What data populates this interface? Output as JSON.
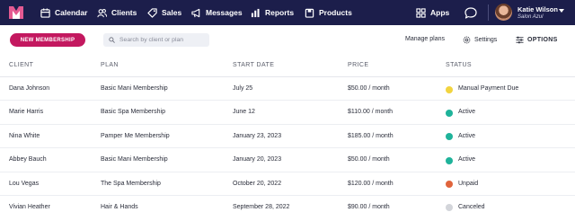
{
  "nav": {
    "items": [
      {
        "label": "Calendar",
        "icon": "calendar-icon"
      },
      {
        "label": "Clients",
        "icon": "users-icon"
      },
      {
        "label": "Sales",
        "icon": "tag-icon"
      },
      {
        "label": "Messages",
        "icon": "megaphone-icon"
      },
      {
        "label": "Reports",
        "icon": "bar-chart-icon"
      },
      {
        "label": "Products",
        "icon": "box-icon"
      },
      {
        "label": "Apps",
        "icon": "grid-icon"
      }
    ],
    "user_name": "Katie Wilson",
    "user_business": "Salon Azul",
    "colors": {
      "bar": "#1c1e4b",
      "logo_a": "#e45a92",
      "logo_b": "#ffffff"
    }
  },
  "toolbar": {
    "new_label": "NEW MEMBERSHIP",
    "search_placeholder": "Search by client or plan",
    "manage_label": "Manage plans",
    "settings_label": "Settings",
    "options_label": "OPTIONS",
    "accent": "#c3185f"
  },
  "table": {
    "headers": [
      "CLIENT",
      "PLAN",
      "START DATE",
      "PRICE",
      "STATUS"
    ],
    "rows": [
      {
        "client": "Dana Johnson",
        "plan": "Basic Mani Membership",
        "start": "July 25",
        "price": "$50.00 / month",
        "status": "Manual Payment Due",
        "color": "#f2d43f"
      },
      {
        "client": "Marie Harris",
        "plan": "Basic Spa Membership",
        "start": "June 12",
        "price": "$110.00 / month",
        "status": "Active",
        "color": "#1fb39a"
      },
      {
        "client": "Nina White",
        "plan": "Pamper Me Membership",
        "start": "January 23, 2023",
        "price": "$185.00 / month",
        "status": "Active",
        "color": "#1fb39a"
      },
      {
        "client": "Abbey Bauch",
        "plan": "Basic Mani Membership",
        "start": "January 20, 2023",
        "price": "$50.00 / month",
        "status": "Active",
        "color": "#1fb39a"
      },
      {
        "client": "Lou Vegas",
        "plan": "The Spa Membership",
        "start": "October 20, 2022",
        "price": "$120.00 / month",
        "status": "Unpaid",
        "color": "#e0643c"
      },
      {
        "client": "Vivian Heather",
        "plan": "Hair & Hands",
        "start": "September 28, 2022",
        "price": "$90.00 / month",
        "status": "Canceled",
        "color": "#d3d5da"
      }
    ]
  }
}
